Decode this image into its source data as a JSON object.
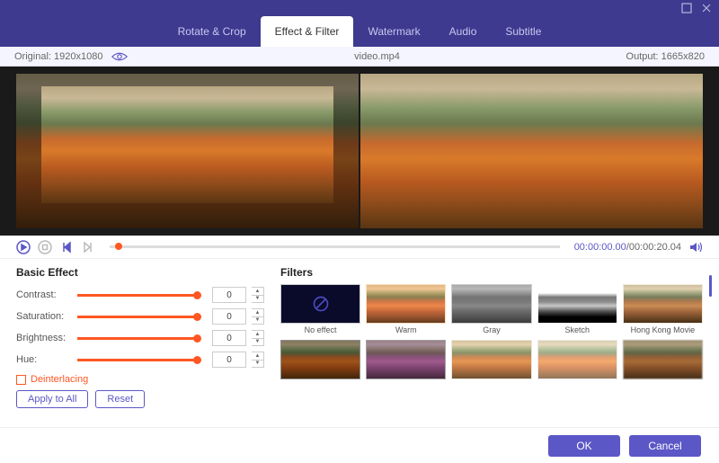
{
  "tabs": {
    "rotate": "Rotate & Crop",
    "effect": "Effect & Filter",
    "watermark": "Watermark",
    "audio": "Audio",
    "subtitle": "Subtitle"
  },
  "info": {
    "original_label": "Original:",
    "original_res": "1920x1080",
    "filename": "video.mp4",
    "output_label": "Output:",
    "output_res": "1665x820"
  },
  "time": {
    "current": "00:00:00.00",
    "total": "00:00:20.04",
    "sep": "/"
  },
  "basic": {
    "heading": "Basic Effect",
    "contrast_label": "Contrast:",
    "saturation_label": "Saturation:",
    "brightness_label": "Brightness:",
    "hue_label": "Hue:",
    "contrast_value": "0",
    "saturation_value": "0",
    "brightness_value": "0",
    "hue_value": "0",
    "deinterlacing": "Deinterlacing",
    "apply_all": "Apply to All",
    "reset": "Reset"
  },
  "filters": {
    "heading": "Filters",
    "items": {
      "none": "No effect",
      "warm": "Warm",
      "gray": "Gray",
      "sketch": "Sketch",
      "hk": "Hong Kong Movie"
    }
  },
  "footer": {
    "ok": "OK",
    "cancel": "Cancel"
  }
}
